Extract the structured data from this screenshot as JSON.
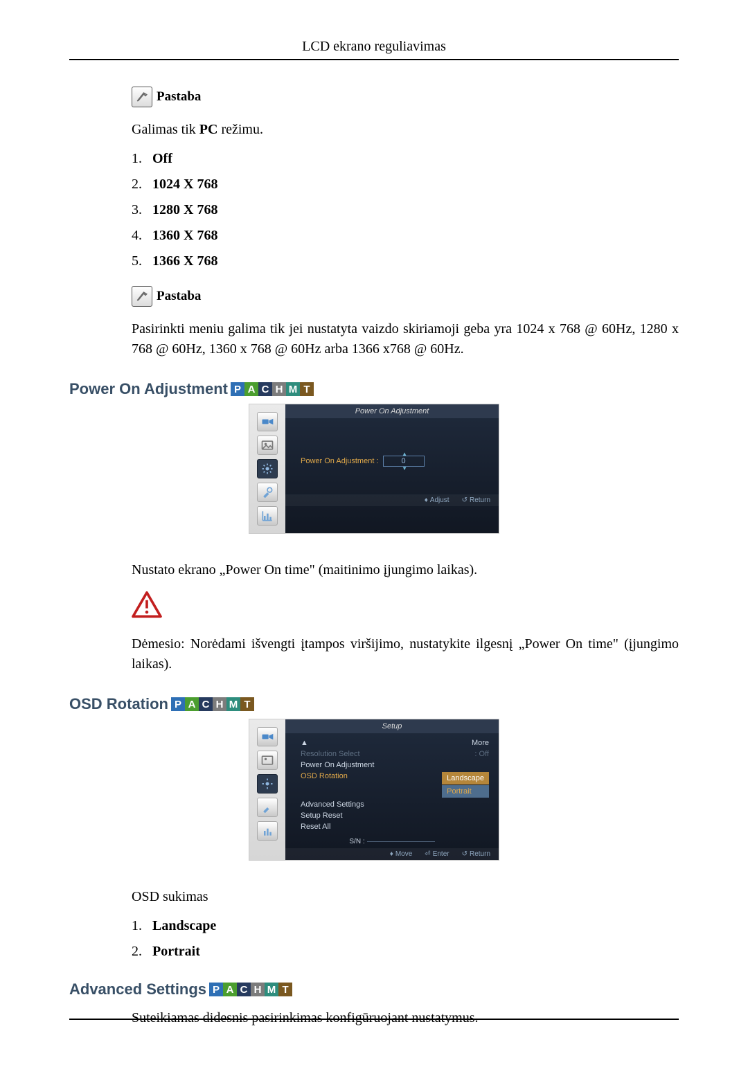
{
  "header": {
    "title": "LCD ekrano reguliavimas"
  },
  "note_label": "Pastaba",
  "sect0": {
    "intro_pre": "Galimas tik ",
    "intro_bold": "PC",
    "intro_post": " režimu.",
    "items": [
      "Off",
      "1024 X 768",
      "1280 X 768",
      "1360 X 768",
      "1366 X 768"
    ],
    "note2": "Pasirinkti meniu galima tik jei nustatyta vaizdo skiriamoji geba yra 1024 x 768 @ 60Hz, 1280 x 768 @ 60Hz, 1360 x 768 @ 60Hz arba 1366 x768 @ 60Hz."
  },
  "sect_pwr": {
    "heading": "Power On Adjustment",
    "osd": {
      "title": "Power On Adjustment",
      "field_label": "Power On Adjustment :",
      "field_value": "0",
      "foot_adjust": "Adjust",
      "foot_return": "Return"
    },
    "desc": "Nustato ekrano „Power On time\" (maitinimo įjungimo laikas).",
    "warn": "Dėmesio: Norėdami išvengti įtampos viršijimo, nustatykite ilgesnį „Power On time\" (įjungimo laikas)."
  },
  "sect_osd": {
    "heading": "OSD Rotation",
    "osd": {
      "title": "Setup",
      "more": "More",
      "items": [
        {
          "label": "Resolution Select",
          "val": "Off",
          "dim": true
        },
        {
          "label": "Power On Adjustment",
          "val": ""
        },
        {
          "label": "OSD Rotation",
          "val": "",
          "orange": true
        },
        {
          "label": "Advanced Settings",
          "val": ""
        },
        {
          "label": "Setup Reset",
          "val": ""
        },
        {
          "label": "Reset All",
          "val": ""
        }
      ],
      "opt_landscape": "Landscape",
      "opt_portrait": "Portrait",
      "sn_label": "S/N :",
      "foot_move": "Move",
      "foot_enter": "Enter",
      "foot_return": "Return"
    },
    "desc": "OSD sukimas",
    "items": [
      "Landscape",
      "Portrait"
    ]
  },
  "sect_adv": {
    "heading": "Advanced Settings",
    "desc": "Suteikiamas didesnis pasirinkimas konfigūruojant nustatymus."
  },
  "badges": [
    "P",
    "A",
    "C",
    "H",
    "M",
    "T"
  ]
}
